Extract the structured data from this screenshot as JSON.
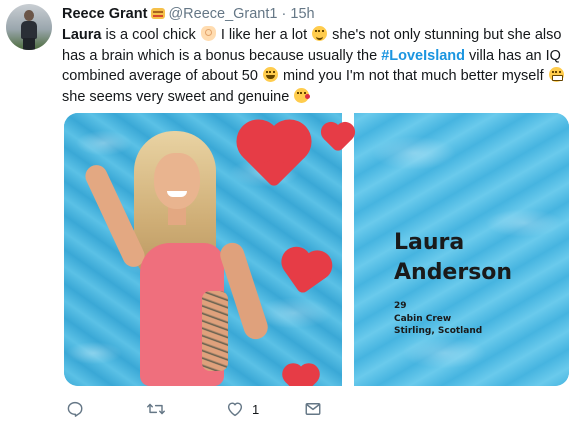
{
  "tweet": {
    "display_name": "Reece Grant",
    "badge_icon": "burger-emoji-icon",
    "handle": "@Reece_Grant1",
    "separator": "·",
    "timestamp": "15h",
    "text": {
      "p1_name": "Laura",
      "p1_text": " is a cool chick ",
      "p2_text": " I like her a lot ",
      "p3_text": " she's not only stunning but she also has a brain which is a bonus because usually the ",
      "hashtag": "#LoveIsland",
      "p4_text": " villa has an IQ combined average of about 50 ",
      "p5_text": " mind you I'm not that much better myself ",
      "p6_text": " she seems very sweet and genuine ",
      "emojis": [
        "ok-hand-emoji-icon",
        "blushing-smile-emoji-icon",
        "tears-of-joy-emoji-icon",
        "grimacing-emoji-icon",
        "face-blowing-kiss-emoji-icon"
      ]
    }
  },
  "media": {
    "card_name_first": "Laura",
    "card_name_last": "Anderson",
    "age": "29",
    "occupation": "Cabin Crew",
    "location": "Stirling, Scotland"
  },
  "actions": {
    "like_count": "1",
    "icons": [
      "reply-icon",
      "retweet-icon",
      "like-heart-icon",
      "direct-message-icon"
    ]
  },
  "colors": {
    "accent": "#1b95e0",
    "text": "#14171a",
    "muted": "#657786",
    "pool": "#4ab6df",
    "heart": "#e63c46",
    "swimsuit": "#ef6f7d"
  }
}
